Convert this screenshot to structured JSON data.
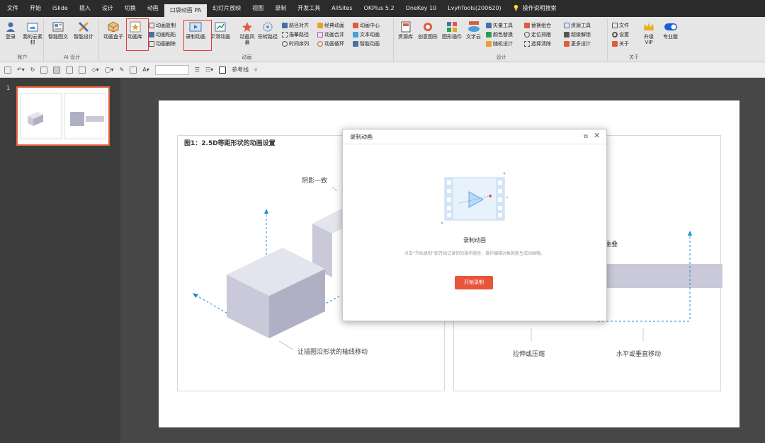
{
  "menubar": {
    "tabs": [
      "文件",
      "开始",
      "iSlide",
      "插入",
      "设计",
      "切换",
      "动画",
      "口袋动画 PA",
      "幻灯片放映",
      "视图",
      "录制",
      "开发工具",
      "AllSites",
      "OKPlus 5.2",
      "OneKey 10",
      "LvyhTools(200620)"
    ],
    "active_tab": "口袋动画 PA",
    "search_label": "操作说明搜索"
  },
  "ribbon": {
    "account": {
      "login": "登录",
      "my_assets": "我的云素材",
      "group": "账户"
    },
    "ai": {
      "smart_text": "智能图文",
      "smart_design": "智能设计",
      "group": "AI 设计"
    },
    "anim": {
      "box": "动画盒子",
      "library": "动画库",
      "copy": "动画复制",
      "paste": "动画粘贴",
      "delete": "动画删除",
      "record": "录制动画",
      "smooth": "平滑动画",
      "wind": "动画风暴",
      "shape_path": "形转路径",
      "path_align": "路径对齐",
      "trace_path": "描摹路径",
      "timeline": "时间序列",
      "classic": "经典动画",
      "merge": "动画合并",
      "loop": "动画循环",
      "center": "动画中心",
      "text_anim": "文本动画",
      "smart_anim": "智能动画",
      "group": "动画"
    },
    "design": {
      "resources": "资源库",
      "creative": "创意图形",
      "shape_plugin": "图形插件",
      "text_cloud": "文字云",
      "vector": "矢量工具",
      "recolor": "颜色替换",
      "random": "随机设计",
      "replace_group": "替换组合",
      "locate": "定位排版",
      "select_clear": "选择清除",
      "res_tool": "资源工具",
      "super_unlock": "超级解锁",
      "more": "更多设计",
      "group": "设计"
    },
    "about": {
      "file": "文件",
      "settings": "设置",
      "about": "关于",
      "upgrade": "升级VIP",
      "pro": "专业版",
      "group": "关于"
    }
  },
  "qat": {
    "ref_line": "参考线"
  },
  "thumbs": {
    "slide_number": "1"
  },
  "slide": {
    "title": "图1：2.5D等距形状的动画设置",
    "label_shadow": "阴影一致",
    "label_axis": "让插图沿形状的轴线移动",
    "label_overlap": "重叠",
    "label_stretch": "拉伸或压缩",
    "label_move": "水平或垂直移动"
  },
  "dialog": {
    "title": "录制动画",
    "heading": "录制动画",
    "description": "点击“开始录制”即开始记录你的操作路径，操作编辑对象就能生成动画哦。",
    "start_button": "开始录制"
  },
  "colors": {
    "accent": "#e8553a",
    "highlight": "#e23b2e",
    "dashed_line": "#1a8fd0",
    "box_front": "#c9c9d9",
    "box_top": "#e4e4ee",
    "box_side": "#b0b0c4"
  }
}
